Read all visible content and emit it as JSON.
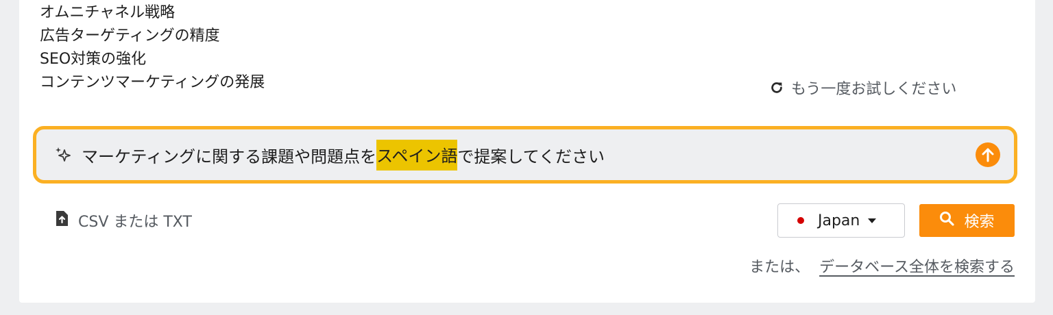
{
  "suggestions": [
    "オムニチャネル戦略",
    "広告ターゲティングの精度",
    "SEO対策の強化",
    "コンテンツマーケティングの発展"
  ],
  "retry": {
    "label": "もう一度お試しください",
    "icon": "refresh-icon"
  },
  "prompt": {
    "before": "マーケティングに関する課題や問題点を",
    "highlight": "スペイン語",
    "after": "で提案してください",
    "icon": "sparkle-icon",
    "send_icon": "arrow-up-icon"
  },
  "upload": {
    "label": "CSV または TXT",
    "icon": "file-upload-icon"
  },
  "country": {
    "selected": "Japan",
    "flag_color": "#d40000"
  },
  "search_button": {
    "label": "検索",
    "icon": "search-icon"
  },
  "alt": {
    "prefix": "または、",
    "link": "データベース全体を検索する"
  },
  "colors": {
    "accent": "#fb8c0b",
    "prompt_border": "#fbb023",
    "highlight": "#ecc400",
    "background": "#eeeff1"
  }
}
